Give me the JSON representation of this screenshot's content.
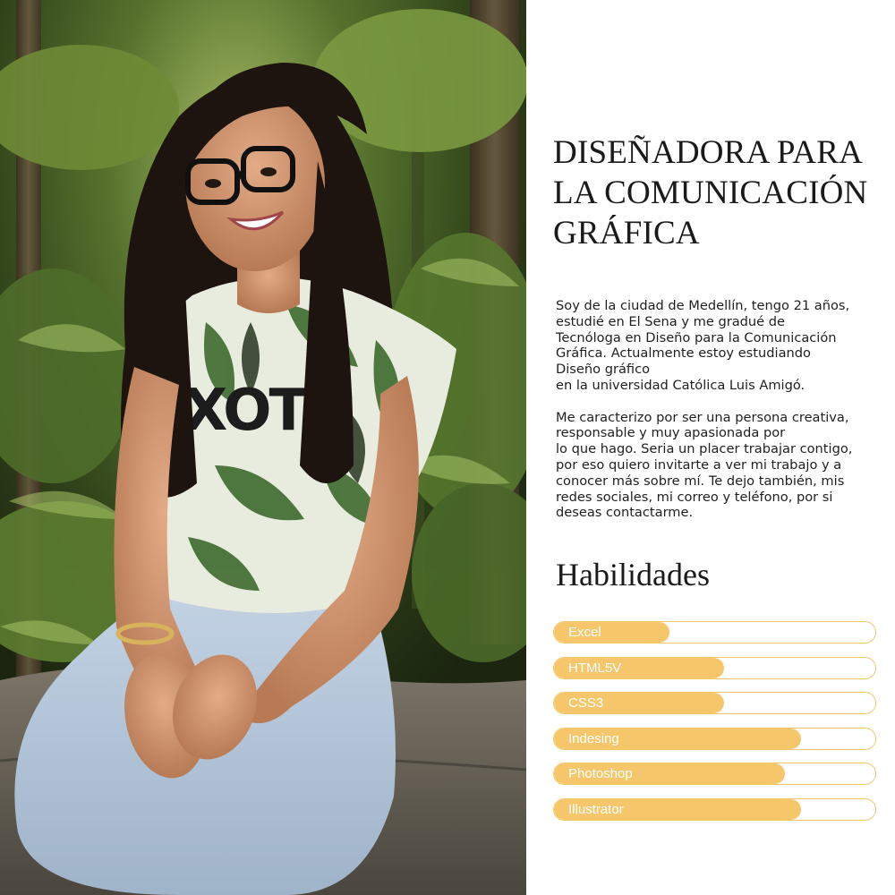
{
  "profile": {
    "title_lines": [
      "DISEÑADORA PARA",
      "LA COMUNICACIÓN",
      "GRÁFICA"
    ],
    "bio_paragraph_1": [
      "Soy de la ciudad de Medellín, tengo 21 años,",
      "estudié en El Sena y me gradué de",
      "Tecnóloga en Diseño para la Comunicación",
      "Gráfica. Actualmente estoy estudiando",
      "Diseño gráfico",
      "en la universidad Católica Luis Amigó."
    ],
    "bio_paragraph_2": [
      "Me caracterizo por ser una persona creativa,",
      "responsable y muy apasionada por",
      "lo que hago. Seria un placer trabajar contigo,",
      "por eso quiero invitarte a ver mi trabajo y a",
      "conocer más sobre mí. Te dejo también, mis",
      "redes sociales, mi correo y teléfono, por si",
      "deseas contactarme."
    ]
  },
  "skills": {
    "heading": "Habilidades",
    "items": [
      {
        "label": "Excel",
        "level": 0.36
      },
      {
        "label": "HTML5V",
        "level": 0.53
      },
      {
        "label": "CSS3",
        "level": 0.53
      },
      {
        "label": "Indesing",
        "level": 0.77
      },
      {
        "label": "Photoshop",
        "level": 0.72
      },
      {
        "label": "Illustrator",
        "level": 0.77
      }
    ]
  },
  "photo": {
    "shirt_text": "XOTT"
  },
  "colors": {
    "accent": "#f6c66b",
    "accent_border": "#f5c76b",
    "text": "#1a1a1a",
    "foliage_dark": "#2d3f1a",
    "foliage_light": "#9fb55f"
  }
}
